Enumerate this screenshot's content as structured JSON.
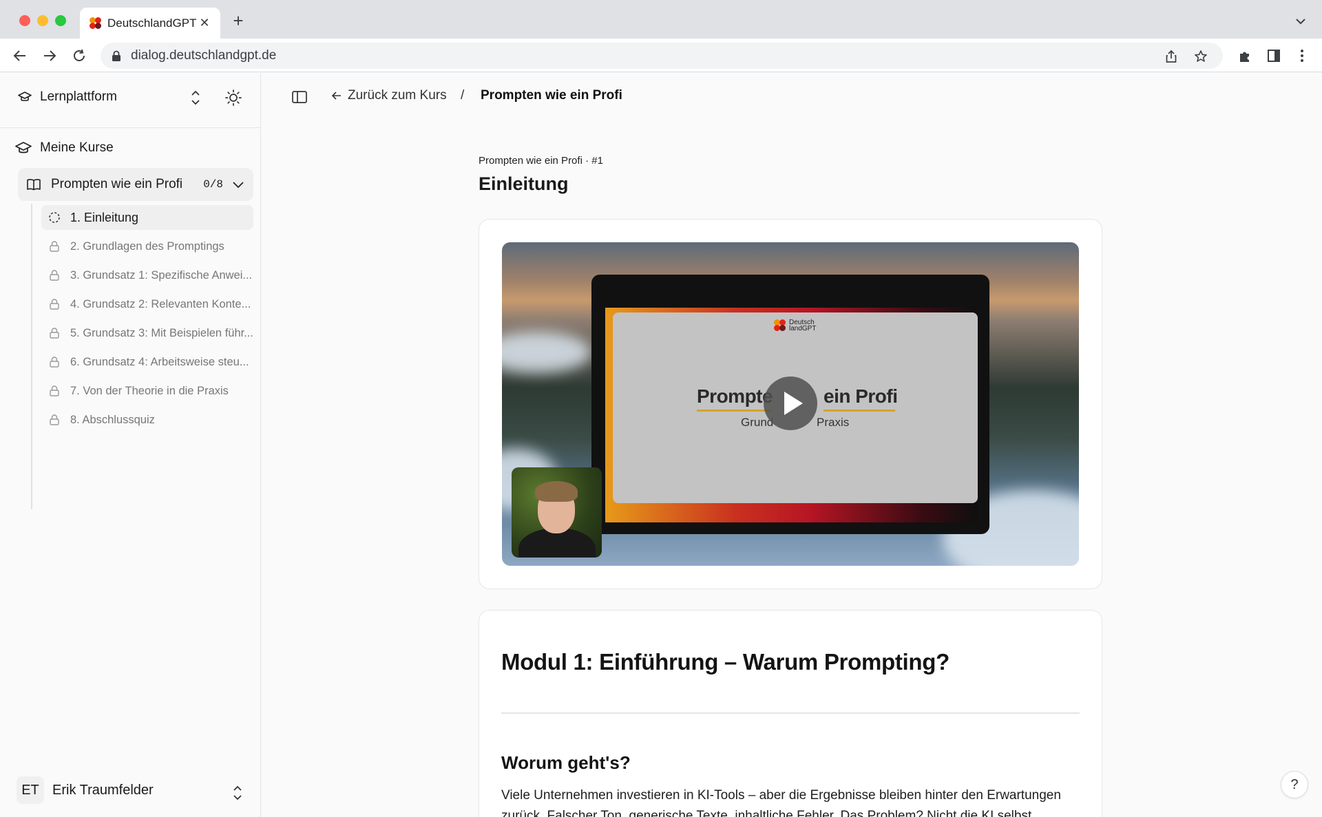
{
  "browser": {
    "tab_title": "DeutschlandGPT",
    "url": "dialog.deutschlandgpt.de",
    "new_tab_label": "+",
    "tab_close_label": "✕",
    "icons": [
      "back-icon",
      "forward-icon",
      "reload-icon",
      "lock-icon",
      "share-icon",
      "bookmark-star-icon",
      "extensions-icon",
      "side-panel-icon",
      "kebab-menu-icon"
    ]
  },
  "brand_colors": {
    "red": "#e2231a",
    "orange": "#f29100",
    "dark": "#6b1b1b",
    "gold": "#d4a22a"
  },
  "sidebar": {
    "platform_label": "Lernplattform",
    "my_courses_label": "Meine Kurse",
    "course": {
      "title": "Prompten wie ein Profi",
      "progress": "0/8"
    },
    "lessons": [
      {
        "label": "1. Einleitung",
        "state": "active"
      },
      {
        "label": "2. Grundlagen des Promptings",
        "state": "locked"
      },
      {
        "label": "3. Grundsatz 1: Spezifische Anwei...",
        "state": "locked"
      },
      {
        "label": "4. Grundsatz 2: Relevanten Konte...",
        "state": "locked"
      },
      {
        "label": "5. Grundsatz 3: Mit Beispielen führ...",
        "state": "locked"
      },
      {
        "label": "6. Grundsatz 4: Arbeitsweise steu...",
        "state": "locked"
      },
      {
        "label": "7. Von der Theorie in die Praxis",
        "state": "locked"
      },
      {
        "label": "8. Abschlussquiz",
        "state": "locked"
      }
    ],
    "user": {
      "initials": "ET",
      "name": "Erik Traumfelder"
    }
  },
  "header": {
    "back_label": "Zurück zum Kurs",
    "separator": "/",
    "current": "Prompten wie ein Profi"
  },
  "lesson": {
    "supertitle": "Prompten wie ein Profi · #1",
    "title": "Einleitung",
    "video": {
      "slide_logo_line1": "Deutsch",
      "slide_logo_line2": "landGPT",
      "slide_title_left": "Prompte",
      "slide_title_right": "ein Profi",
      "slide_sub_left": "Grund",
      "slide_sub_right": "Praxis"
    },
    "module_heading": "Modul 1: Einführung – Warum Prompting?",
    "section_heading": "Worum geht's?",
    "paragraph": "Viele Unternehmen investieren in KI-Tools – aber die Ergebnisse bleiben hinter den Erwartungen zurück. Falscher Ton, generische Texte, inhaltliche Fehler. Das Problem? Nicht die KI selbst."
  },
  "help_label": "?"
}
